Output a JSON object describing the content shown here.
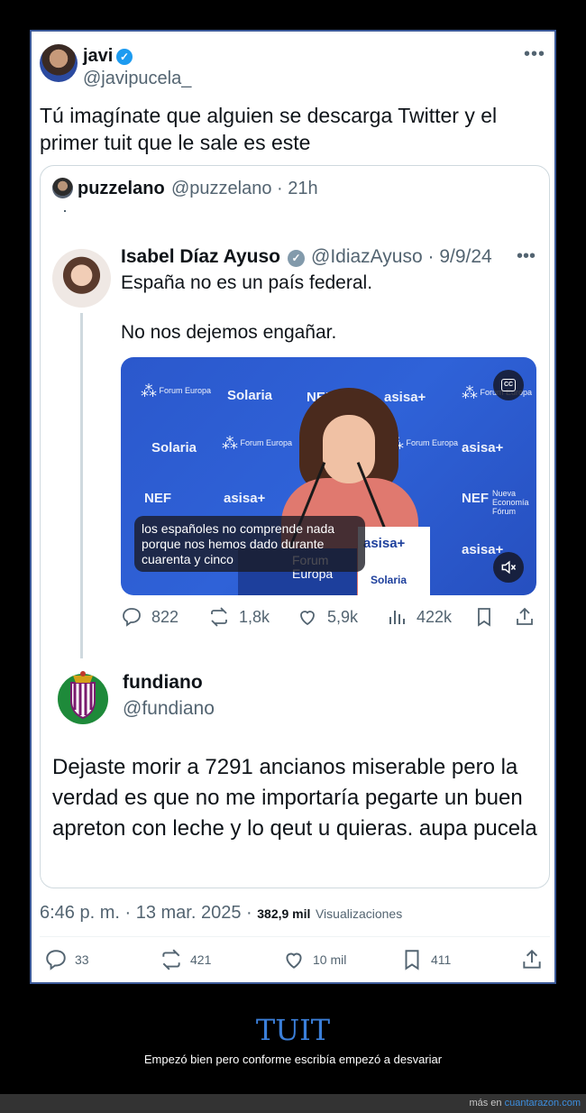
{
  "tweet": {
    "author_name": "javi",
    "author_handle": "@javipucela_",
    "more_label": "•••",
    "text": "Tú imagínate que alguien se descarga Twitter y el primer tuit que le sale es este",
    "timestamp": "6:46 p. m. · 13 mar. 2025 ·",
    "views_count": "382,9 mil",
    "views_label": "Visualizaciones",
    "stats": {
      "replies": "33",
      "retweets": "421",
      "likes": "10 mil",
      "bookmarks": "411"
    }
  },
  "quoted": {
    "author_name": "puzzelano",
    "author_meta": "@puzzelano · 21h",
    "dot": "."
  },
  "reply_parent": {
    "author_name": "Isabel Díaz Ayuso",
    "author_meta": "@IdiazAyuso · 9/9/24",
    "text_line1": "España no es un país federal.",
    "text_line2": "No nos dejemos engañar.",
    "video_subtitles": [
      "los españoles no comprende nada",
      "porque nos hemos dado durante",
      "cuarenta y cinco"
    ],
    "video_logos": {
      "forum": "Forum Europa",
      "solaria": "Solaria",
      "asisa": "asisa+",
      "nef": "NEF",
      "nef_small": "Nueva Economía Fórum",
      "cc": "CC"
    },
    "stats": {
      "replies": "822",
      "retweets": "1,8k",
      "likes": "5,9k",
      "views": "422k"
    }
  },
  "reply": {
    "author_name": "fundiano",
    "author_handle": "@fundiano",
    "text": "Dejaste morir a 7291 ancianos miserable pero la verdad es que no me importaría pegarte un buen apreton con leche y lo qeut u quieras. aupa pucela"
  },
  "caption": {
    "title": "TUIT",
    "subtitle": "Empezó bien pero conforme escribía empezó a desvariar"
  },
  "footer": {
    "prefix": "más en",
    "site": "cuantarazon.com"
  },
  "colors": {
    "accent": "#1d9bf0",
    "caption_title": "#3b7fd9",
    "frame_border": "#3b5998"
  }
}
